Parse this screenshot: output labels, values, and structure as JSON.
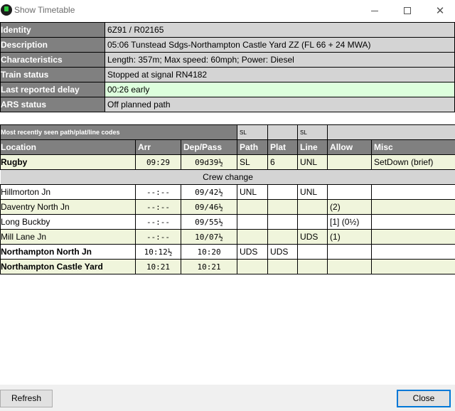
{
  "window": {
    "title": "Show Timetable",
    "icon": "app-icon",
    "controls": [
      "minimize-icon",
      "maximize-icon",
      "close-icon"
    ]
  },
  "info": [
    {
      "label": "Identity",
      "value": "6Z91 / R02165"
    },
    {
      "label": "Description",
      "value": "05:06 Tunstead Sdgs-Northampton Castle Yard ZZ (FL 66 + 24 MWA)"
    },
    {
      "label": "Characteristics",
      "value": "Length: 357m; Max speed: 60mph; Power: Diesel"
    },
    {
      "label": "Train status",
      "value": "Stopped at signal RN4182"
    },
    {
      "label": "Last reported delay",
      "value": "00:26 early"
    },
    {
      "label": "ARS status",
      "value": "Off planned path"
    }
  ],
  "timetable": {
    "subheader": {
      "title": "Most recently seen path/plat/line codes",
      "path_code": "SL",
      "plat_code": "",
      "line_code": "SL"
    },
    "columns": [
      "Location",
      "Arr",
      "Dep/Pass",
      "Path",
      "Plat",
      "Line",
      "Allow",
      "Misc"
    ],
    "rows": [
      {
        "location": "Rugby",
        "arr": "09:29",
        "dep": "09d39½",
        "path": "SL",
        "plat": "6",
        "line": "UNL",
        "allow": "",
        "misc": "SetDown (brief)"
      },
      {
        "location": "Hillmorton Jn",
        "arr": "--:--",
        "dep": "09/42½",
        "path": "UNL",
        "plat": "",
        "line": "UNL",
        "allow": "",
        "misc": ""
      },
      {
        "location": "Daventry North Jn",
        "arr": "--:--",
        "dep": "09/46½",
        "path": "",
        "plat": "",
        "line": "",
        "allow": "(2)",
        "misc": ""
      },
      {
        "location": "Long Buckby",
        "arr": "--:--",
        "dep": "09/55½",
        "path": "",
        "plat": "",
        "line": "",
        "allow": "[1] (0½)",
        "misc": ""
      },
      {
        "location": "Mill Lane Jn",
        "arr": "--:--",
        "dep": "10/07½",
        "path": "",
        "plat": "",
        "line": "UDS",
        "allow": "(1)",
        "misc": ""
      },
      {
        "location": "Northampton North Jn",
        "arr": "10:12½",
        "dep": "10:20",
        "path": "UDS",
        "plat": "UDS",
        "line": "",
        "allow": "",
        "misc": ""
      },
      {
        "location": "Northampton Castle Yard",
        "arr": "10:21",
        "dep": "10:21",
        "path": "",
        "plat": "",
        "line": "",
        "allow": "",
        "misc": ""
      }
    ],
    "crew_change": "Crew change"
  },
  "buttons": {
    "refresh": "Refresh",
    "close": "Close"
  },
  "colors": {
    "header_dark": "#808080",
    "value_grey": "#d4d4d4",
    "delay_green": "#ddffdd",
    "row_green": "#f0f5dc"
  }
}
